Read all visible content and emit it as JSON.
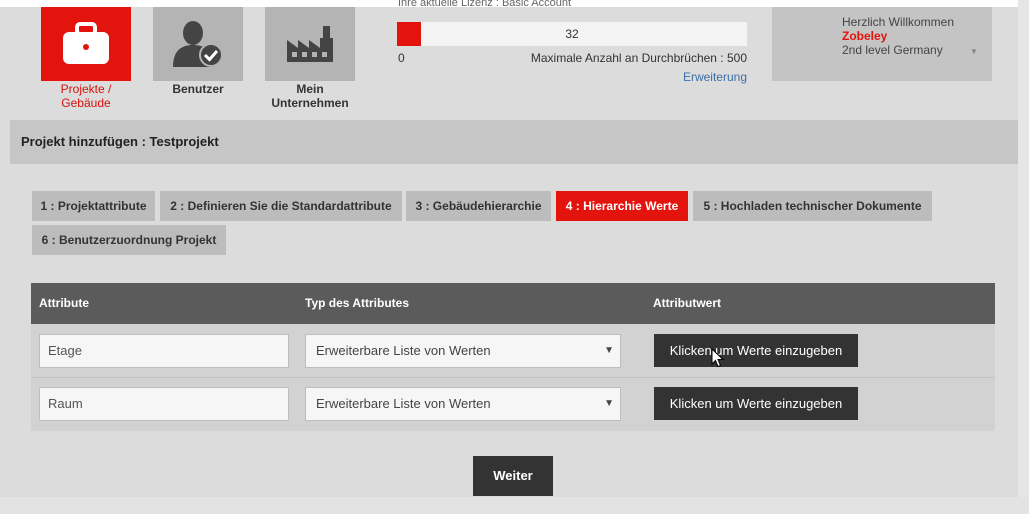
{
  "nav": {
    "projects": {
      "label_line1": "Projekte /",
      "label_line2": "Gebäude",
      "icon": "briefcase-icon"
    },
    "users": {
      "label": "Benutzer",
      "icon": "user-check-icon"
    },
    "company": {
      "label_line1": "Mein",
      "label_line2": "Unternehmen",
      "icon": "factory-icon"
    }
  },
  "license": {
    "caption": "Ihre aktuelle Lizenz : Basic Account",
    "current": 32,
    "min_label": "0",
    "max_label": "Maximale Anzahl an Durchbrüchen : 500",
    "max": 500,
    "link": "Erweiterung"
  },
  "user": {
    "greeting": "Herzlich Willkommen",
    "name": "Zobeley",
    "role": "2nd level Germany"
  },
  "page_title": "Projekt hinzufügen : Testprojekt",
  "steps": [
    "1 : Projektattribute",
    "2 : Definieren Sie die Standardattribute",
    "3 : Gebäudehierarchie",
    "4 : Hierarchie Werte",
    "5 : Hochladen technischer Dokumente",
    "6 : Benutzerzuordnung Projekt"
  ],
  "active_step": 4,
  "table": {
    "headers": [
      "Attribute",
      "Typ des Attributes",
      "Attributwert"
    ],
    "rows": [
      {
        "attribute": "Etage",
        "type": "Erweiterbare Liste von Werten",
        "button": "Klicken um Werte einzugeben"
      },
      {
        "attribute": "Raum",
        "type": "Erweiterbare Liste von Werten",
        "button": "Klicken um Werte einzugeben"
      }
    ]
  },
  "next_button": "Weiter",
  "colors": {
    "accent": "#e3130d",
    "dark": "#333333",
    "header": "#5b5b5b",
    "link": "#3d6ea8"
  }
}
